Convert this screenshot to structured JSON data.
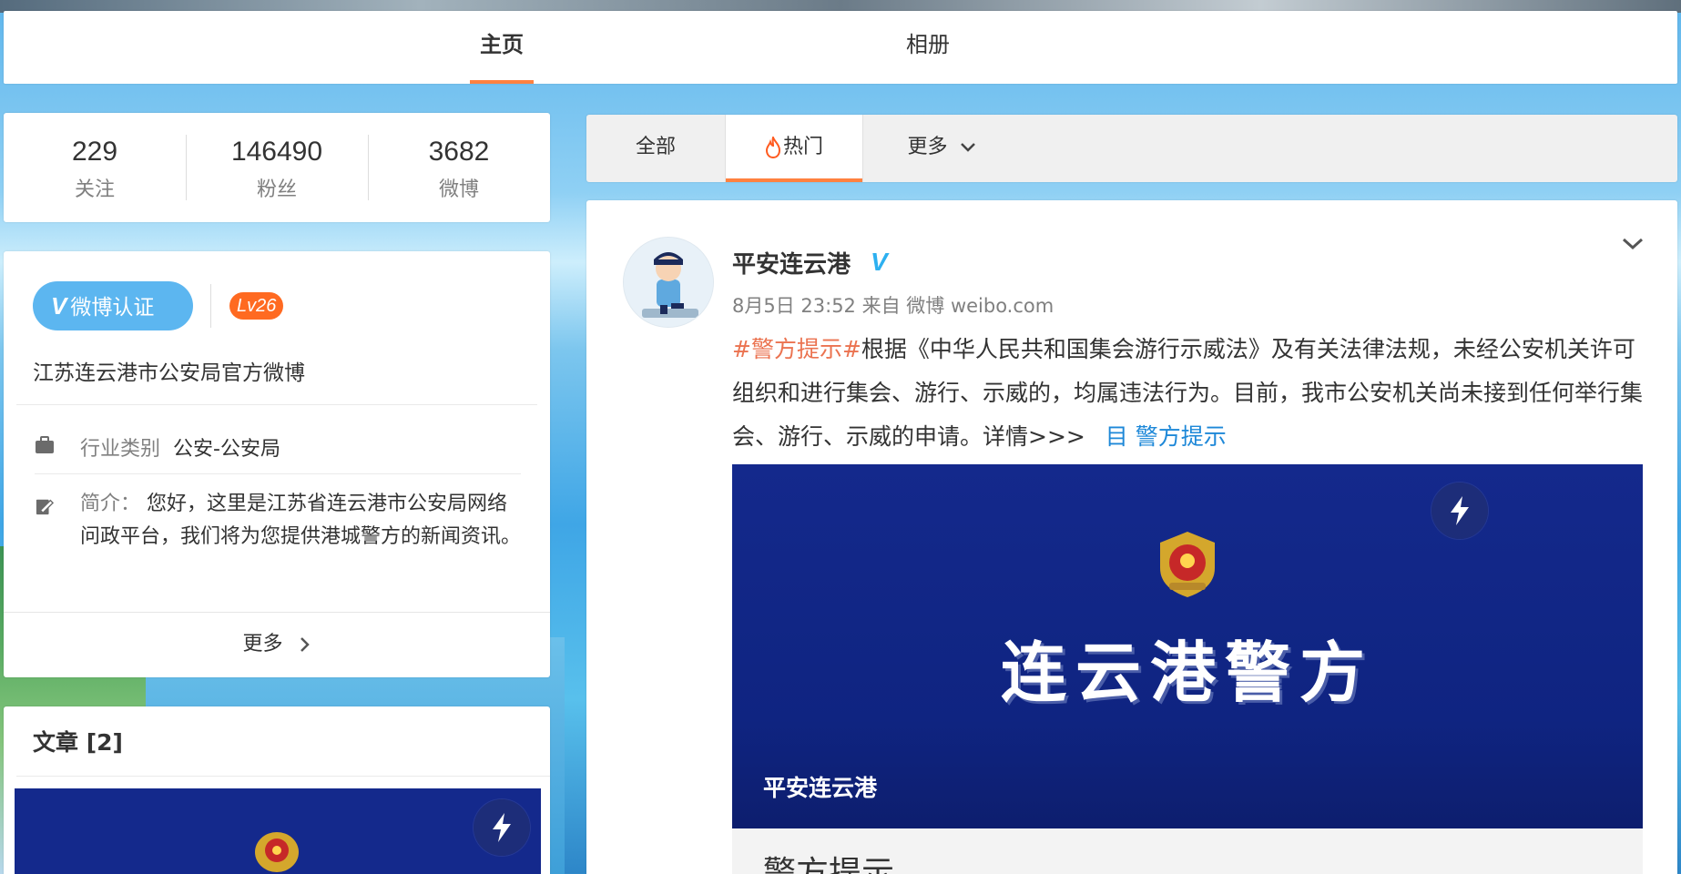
{
  "top_tabs": [
    {
      "label": "主页",
      "active": true
    },
    {
      "label": "相册",
      "active": false
    }
  ],
  "stats": [
    {
      "value": "229",
      "label": "关注"
    },
    {
      "value": "146490",
      "label": "粉丝"
    },
    {
      "value": "3682",
      "label": "微博"
    }
  ],
  "profile": {
    "verify_label": "微博认证",
    "verify_icon": "V",
    "level": "Lv26",
    "official_desc": "江苏连云港市公安局官方微博",
    "industry_label": "行业类别",
    "industry_value": "公安-公安局",
    "intro_label": "简介：",
    "intro_text": "您好，这里是江苏省连云港市公安局网络问政平台，我们将为您提供港城警方的新闻资讯。",
    "more_label": "更多"
  },
  "articles": {
    "title": "文章 [2]"
  },
  "feed_tabs": [
    {
      "label": "全部",
      "active": false
    },
    {
      "label": "热门",
      "active": true
    },
    {
      "label": "更多",
      "active": false
    }
  ],
  "post": {
    "author": "平安连云港",
    "verified_mark": "V",
    "meta": "8月5日 23:52 来自 微博 weibo.com",
    "topic": "#警方提示#",
    "text": "根据《中华人民共和国集会游行示威法》及有关法律法规，未经公安机关许可组织和进行集会、游行、示威的，均属违法行为。目前，我市公安机关尚未接到任何举行集会、游行、示威的申请。详情>>>",
    "link_icon": "目",
    "link_text": "警方提示",
    "image_title": "连云港警方",
    "image_caption": "平安连云港",
    "sub_title": "警方提示"
  },
  "colors": {
    "accent": "#ff8140",
    "verify_blue": "#5cb6f0",
    "level_orange": "#ff6a21",
    "topic": "#eb7350",
    "link": "#1e88d8",
    "image_bg": "#14298c"
  }
}
